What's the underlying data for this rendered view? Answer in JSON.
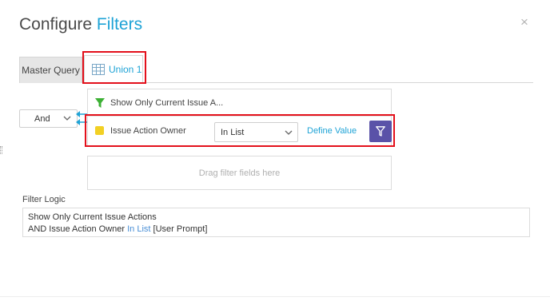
{
  "dialog": {
    "title_prefix": "Configure",
    "title_accent": "Filters",
    "close_glyph": "×"
  },
  "tabs": [
    {
      "label": "Master Query",
      "icon": "",
      "active": false
    },
    {
      "label": "Union 1",
      "icon": "table-grid-icon",
      "active": true
    }
  ],
  "logic_operator": {
    "value": "And"
  },
  "filters": [
    {
      "label": "Show Only Current Issue A...",
      "icon": "funnel-icon",
      "icon_color": "#3cb034"
    },
    {
      "label": "Issue Action Owner",
      "icon": "yellow-square-icon",
      "icon_color": "#f2d024",
      "operator": "In List",
      "define_label": "Define Value",
      "button_icon": "filter-icon",
      "button_color": "#5a52a8"
    }
  ],
  "dropzone": {
    "placeholder": "Drag filter fields here"
  },
  "filter_logic": {
    "label": "Filter Logic",
    "line1": "Show Only Current Issue Actions",
    "line2_prefix": "AND Issue Action Owner ",
    "line2_op": "In List",
    "line2_suffix": " [User Prompt]"
  },
  "colors": {
    "accent": "#1ea3d6",
    "highlight": "#e3101b",
    "connector": "#1ea3d6"
  }
}
